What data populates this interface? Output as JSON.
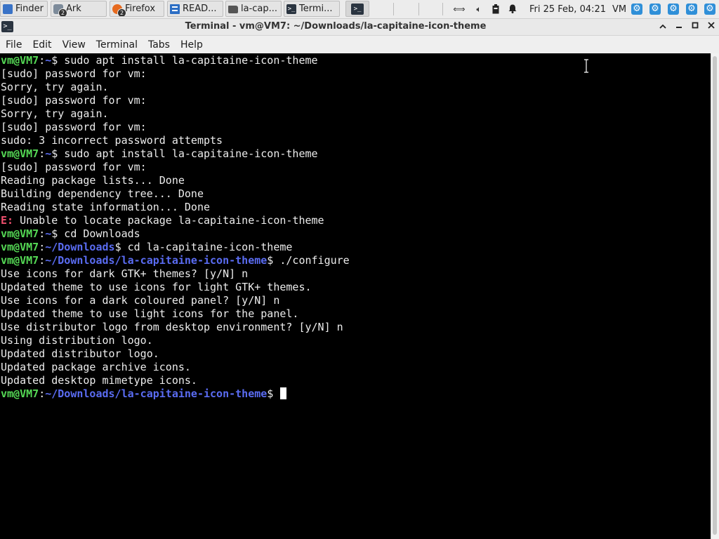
{
  "panel": {
    "tasks": [
      {
        "label": "Finder",
        "icon": "finder-icon"
      },
      {
        "label": "Ark",
        "icon": "ark-icon",
        "badge": "2"
      },
      {
        "label": "Firefox",
        "icon": "firefox-icon",
        "badge": "2"
      },
      {
        "label": "READ...",
        "icon": "document-icon"
      },
      {
        "label": "la-cap...",
        "icon": "folder-icon"
      },
      {
        "label": "Termi...",
        "icon": "terminal-icon"
      }
    ],
    "clock": "Fri 25 Feb, 04:21",
    "user": "VM"
  },
  "window": {
    "title": "Terminal - vm@VM7: ~/Downloads/la-capitaine-icon-theme"
  },
  "menubar": [
    "File",
    "Edit",
    "View",
    "Terminal",
    "Tabs",
    "Help"
  ],
  "terminal": {
    "lines": [
      {
        "kind": "prompt",
        "user": "vm@VM7",
        "path": "~",
        "cmd": " sudo apt install la-capitaine-icon-theme"
      },
      {
        "kind": "text",
        "text": "[sudo] password for vm:"
      },
      {
        "kind": "text",
        "text": "Sorry, try again."
      },
      {
        "kind": "text",
        "text": "[sudo] password for vm:"
      },
      {
        "kind": "text",
        "text": "Sorry, try again."
      },
      {
        "kind": "text",
        "text": "[sudo] password for vm:"
      },
      {
        "kind": "text",
        "text": "sudo: 3 incorrect password attempts"
      },
      {
        "kind": "prompt",
        "user": "vm@VM7",
        "path": "~",
        "cmd": " sudo apt install la-capitaine-icon-theme"
      },
      {
        "kind": "text",
        "text": "[sudo] password for vm:"
      },
      {
        "kind": "text",
        "text": "Reading package lists... Done"
      },
      {
        "kind": "text",
        "text": "Building dependency tree... Done"
      },
      {
        "kind": "text",
        "text": "Reading state information... Done"
      },
      {
        "kind": "error",
        "tag": "E:",
        "text": " Unable to locate package la-capitaine-icon-theme"
      },
      {
        "kind": "prompt",
        "user": "vm@VM7",
        "path": "~",
        "cmd": " cd Downloads"
      },
      {
        "kind": "prompt",
        "user": "vm@VM7",
        "path": "~/Downloads",
        "cmd": " cd la-capitaine-icon-theme"
      },
      {
        "kind": "prompt",
        "user": "vm@VM7",
        "path": "~/Downloads/la-capitaine-icon-theme",
        "cmd": " ./configure"
      },
      {
        "kind": "text",
        "text": "Use icons for dark GTK+ themes? [y/N] n"
      },
      {
        "kind": "text",
        "text": "Updated theme to use icons for light GTK+ themes."
      },
      {
        "kind": "text",
        "text": "Use icons for a dark coloured panel? [y/N] n"
      },
      {
        "kind": "text",
        "text": "Updated theme to use light icons for the panel."
      },
      {
        "kind": "text",
        "text": "Use distributor logo from desktop environment? [y/N] n"
      },
      {
        "kind": "text",
        "text": "Using distribution logo."
      },
      {
        "kind": "text",
        "text": "Updated distributor logo."
      },
      {
        "kind": "text",
        "text": "Updated package archive icons."
      },
      {
        "kind": "text",
        "text": "Updated desktop mimetype icons."
      },
      {
        "kind": "prompt",
        "user": "vm@VM7",
        "path": "~/Downloads/la-capitaine-icon-theme",
        "cmd": " ",
        "cursor": true
      }
    ]
  },
  "colors": {
    "prompt_user": "#55d955",
    "prompt_path": "#5a6cf2",
    "error_tag": "#f0506e",
    "terminal_bg": "#000000",
    "terminal_fg": "#ececec",
    "tray_gear": "#2f8fd8"
  }
}
